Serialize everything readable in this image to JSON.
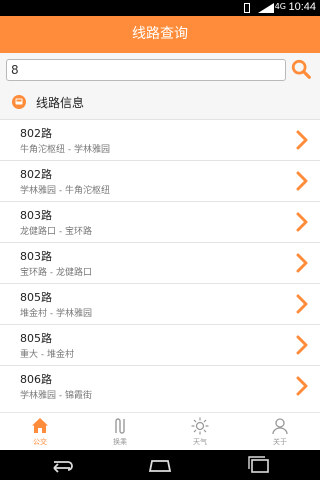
{
  "status_bar": {
    "signal_label": "4G",
    "time": "10:44"
  },
  "header": {
    "title": "线路查询"
  },
  "search": {
    "value": "8"
  },
  "section": {
    "title": "线路信息"
  },
  "lines": [
    {
      "number": "802路",
      "route": "牛角沱枢纽 - 学林雅园"
    },
    {
      "number": "802路",
      "route": "学林雅园 - 牛角沱枢纽"
    },
    {
      "number": "803路",
      "route": "龙健路口 - 宝环路"
    },
    {
      "number": "803路",
      "route": "宝环路 - 龙健路口"
    },
    {
      "number": "805路",
      "route": "堆金村 - 学林雅园"
    },
    {
      "number": "805路",
      "route": "重大 - 堆金村"
    },
    {
      "number": "806路",
      "route": "学林雅园 - 锦霞街"
    }
  ],
  "tabs": [
    {
      "label": "公交",
      "icon": "home-icon",
      "active": true
    },
    {
      "label": "换乘",
      "icon": "transfer-icon",
      "active": false
    },
    {
      "label": "天气",
      "icon": "sun-icon",
      "active": false
    },
    {
      "label": "关于",
      "icon": "user-icon",
      "active": false
    }
  ],
  "colors": {
    "accent": "#ff8c3a",
    "inactive": "#999999",
    "section_bg": "#f6f6f6"
  }
}
